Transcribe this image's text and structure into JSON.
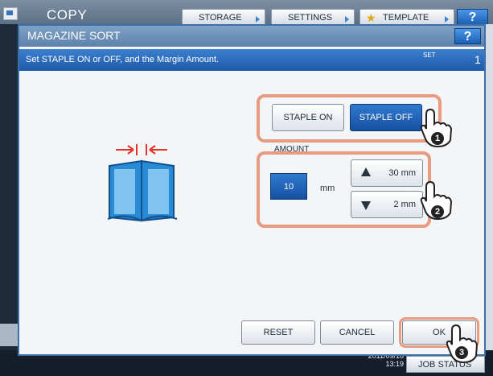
{
  "header": {
    "title": "COPY",
    "tabs": [
      "STORAGE",
      "SETTINGS",
      "TEMPLATE"
    ],
    "help_label": "?"
  },
  "dialog": {
    "title": "MAGAZINE SORT",
    "help_label": "?",
    "message": "Set STAPLE ON or OFF, and the Margin Amount.",
    "set_label": "SET",
    "set_value": "1"
  },
  "staple": {
    "on_label": "STAPLE ON",
    "off_label": "STAPLE OFF",
    "selected": "STAPLE OFF"
  },
  "amount": {
    "label": "AMOUNT",
    "value": "10",
    "unit": "mm",
    "max_label": "30 mm",
    "min_label": "2 mm"
  },
  "actions": {
    "reset": "RESET",
    "cancel": "CANCEL",
    "ok": "OK"
  },
  "footer": {
    "date": "2011/09/16",
    "time": "13:19",
    "job_status": "JOB STATUS"
  },
  "callouts": [
    "1",
    "2",
    "3"
  ],
  "colors": {
    "accent": "#1f5fb4",
    "highlight": "#e89b80",
    "arrow": "#e8312a",
    "book": "#2a8ad4"
  }
}
